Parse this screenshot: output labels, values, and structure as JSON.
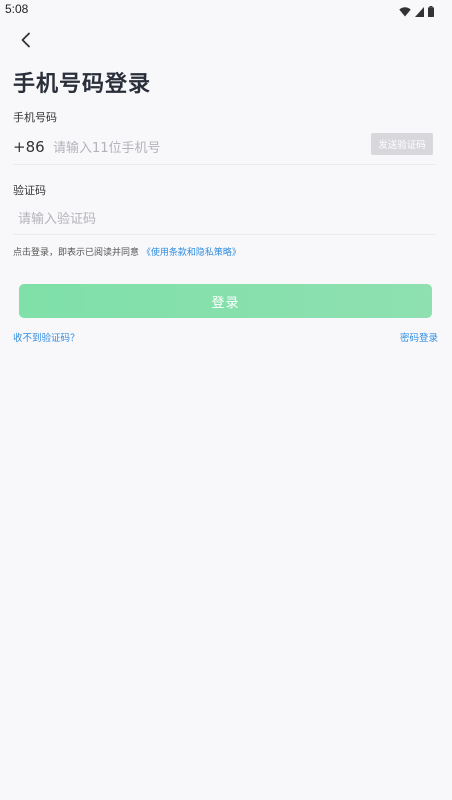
{
  "status_bar": {
    "time": "5:08"
  },
  "header": {
    "title": "手机号码登录"
  },
  "phone": {
    "label": "手机号码",
    "country_code": "+86",
    "placeholder": "请输入11位手机号",
    "value": "",
    "send_code_label": "发送验证码"
  },
  "code": {
    "label": "验证码",
    "placeholder": "请输入验证码",
    "value": ""
  },
  "agreement": {
    "prefix": "点击登录，即表示已阅读并同意",
    "link": "《使用条款和隐私策略》"
  },
  "login_button_label": "登录",
  "footer": {
    "no_code_label": "收不到验证码？",
    "password_login_label": "密码登录"
  },
  "colors": {
    "primary_green": "#7fe0a8",
    "link_blue": "#2f8de0",
    "background": "#f8f8fa"
  },
  "icons": {
    "back": "chevron-left-icon",
    "wifi": "wifi-icon",
    "signal": "signal-icon",
    "battery": "battery-icon"
  }
}
